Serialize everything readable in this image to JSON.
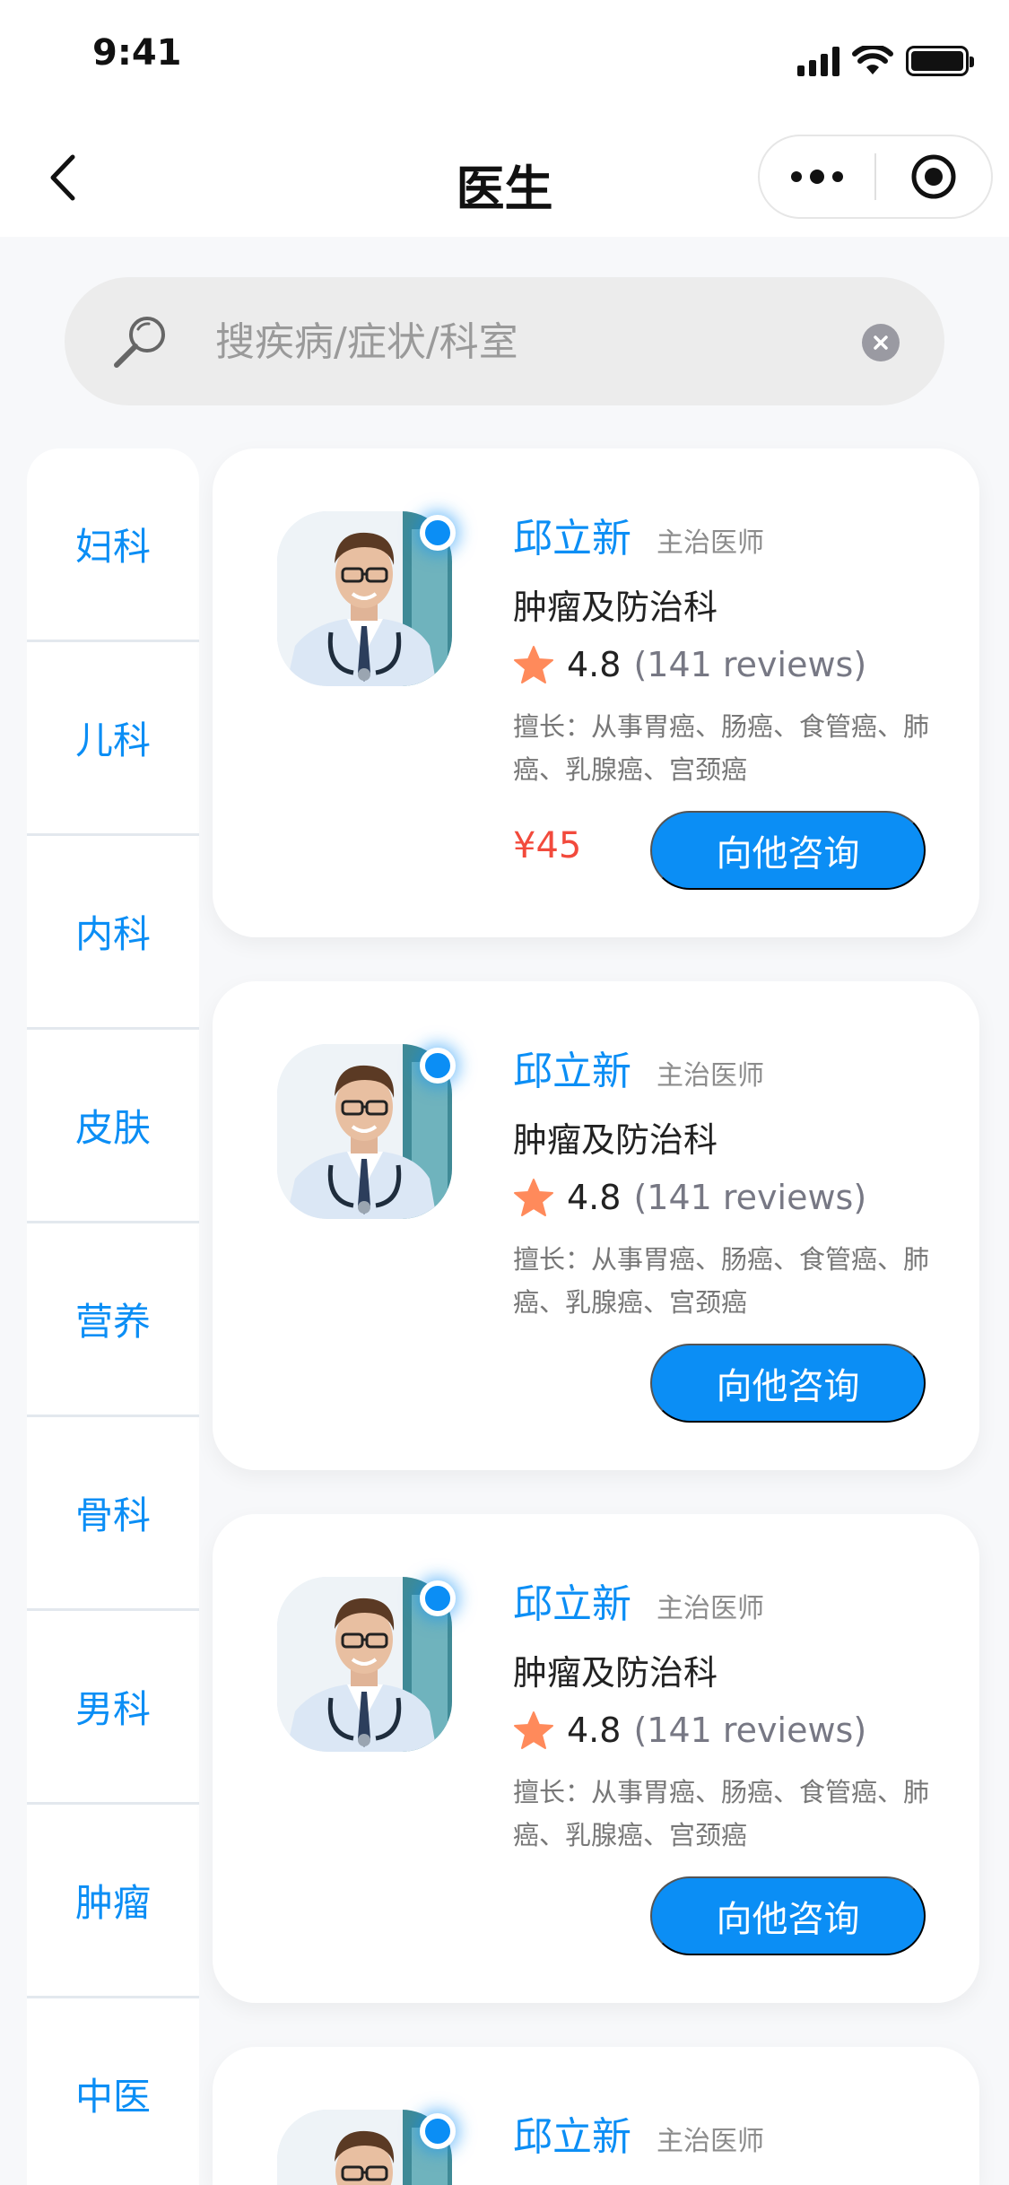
{
  "status_bar": {
    "time": "9:41"
  },
  "nav": {
    "title": "医生"
  },
  "search": {
    "placeholder": "搜疾病/症状/科室"
  },
  "categories": [
    "妇科",
    "儿科",
    "内科",
    "皮肤",
    "营养",
    "骨科",
    "男科",
    "肿瘤",
    "中医"
  ],
  "doctors": [
    {
      "name": "邱立新",
      "title": "主治医师",
      "department": "肿瘤及防治科",
      "rating": "4.8",
      "reviews": "(141 reviews)",
      "skill": "擅长：从事胃癌、肠癌、食管癌、肺癌、乳腺癌、宫颈癌",
      "price": "¥45",
      "button_label": "向他咨询"
    },
    {
      "name": "邱立新",
      "title": "主治医师",
      "department": "肿瘤及防治科",
      "rating": "4.8",
      "reviews": "(141 reviews)",
      "skill": "擅长：从事胃癌、肠癌、食管癌、肺癌、乳腺癌、宫颈癌",
      "price": "",
      "button_label": "向他咨询"
    },
    {
      "name": "邱立新",
      "title": "主治医师",
      "department": "肿瘤及防治科",
      "rating": "4.8",
      "reviews": "(141 reviews)",
      "skill": "擅长：从事胃癌、肠癌、食管癌、肺癌、乳腺癌、宫颈癌",
      "price": "",
      "button_label": "向他咨询"
    },
    {
      "name": "邱立新",
      "title": "主治医师"
    }
  ],
  "icons": {
    "back": "chevron-left-icon",
    "more": "more-dots-icon",
    "target": "target-icon",
    "search": "magnifier-icon",
    "clear": "clear-icon",
    "star": "star-icon",
    "online": "online-dot-icon"
  },
  "colors": {
    "accent": "#0b8ef5",
    "price": "#f24a3c",
    "star": "#ff8a5b",
    "background": "#f7f8fa"
  }
}
